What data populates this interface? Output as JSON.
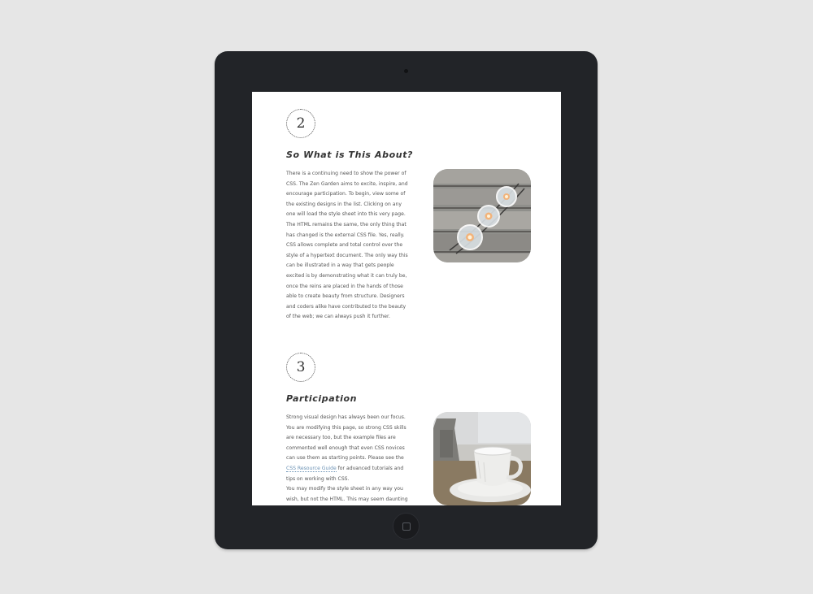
{
  "sections": [
    {
      "number": "2",
      "heading": "So What is This About?",
      "paragraphs": [
        "There is a continuing need to show the power of CSS. The Zen Garden aims to excite, inspire, and encourage participation. To begin, view some of the existing designs in the list. Clicking on any one will load the style sheet into this very page. The HTML remains the same, the only thing that has changed is the external CSS file. Yes, really.",
        "CSS allows complete and total control over the style of a hypertext document. The only way this can be illustrated in a way that gets people excited is by demonstrating what it can truly be, once the reins are placed in the hands of those able to create beauty from structure. Designers and coders alike have contributed to the beauty of the web; we can always push it further."
      ],
      "photo_icon": "candle-jars-photo"
    },
    {
      "number": "3",
      "heading": "Participation",
      "paragraphs": [
        "Strong visual design has always been our focus. You are modifying this page, so strong CSS skills are necessary too, but the example files are commented well enough that even CSS novices can use them as starting points. Please see the",
        "CSS Resource Guide",
        "for advanced tutorials and tips on working with CSS.",
        "You may modify the style sheet in any way you wish, but not the HTML. This may seem daunting at first if you've never worked this way before, but follow the listed links to learn more, and use the sample files as a guide."
      ],
      "photo_icon": "coffee-cup-photo"
    }
  ],
  "colors": {
    "background": "#e6e6e6",
    "device": "#222428",
    "link": "#6c93b5"
  }
}
